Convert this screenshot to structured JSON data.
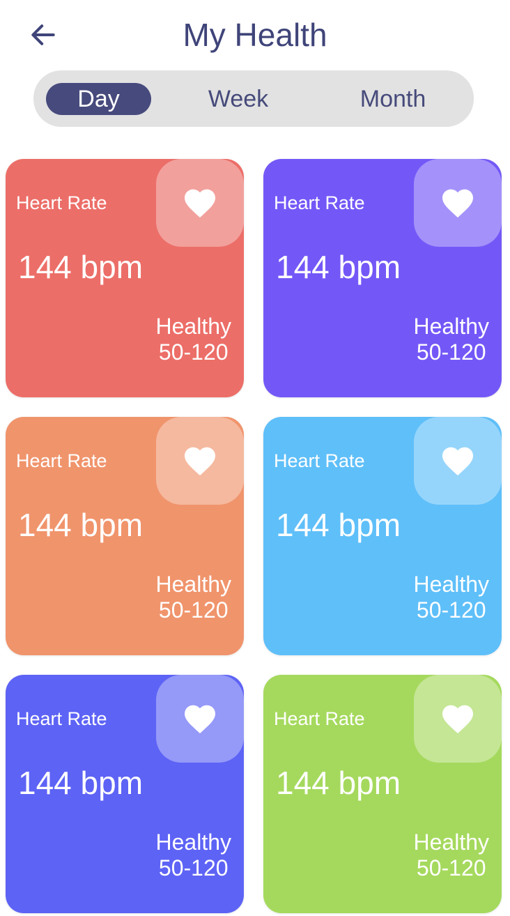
{
  "header": {
    "title": "My Health",
    "back_icon": "arrow-left-icon"
  },
  "tabs": [
    {
      "label": "Day",
      "active": true
    },
    {
      "label": "Week",
      "active": false
    },
    {
      "label": "Month",
      "active": false
    }
  ],
  "cards": [
    {
      "label": "Heart Rate",
      "value": "144 bpm",
      "status": "Healthy",
      "range": "50-120",
      "icon": "heart-icon",
      "color": "#ec6e68"
    },
    {
      "label": "Heart Rate",
      "value": "144 bpm",
      "status": "Healthy",
      "range": "50-120",
      "icon": "heart-icon",
      "color": "#7458f7"
    },
    {
      "label": "Heart Rate",
      "value": "144 bpm",
      "status": "Healthy",
      "range": "50-120",
      "icon": "heart-icon",
      "color": "#f0946c"
    },
    {
      "label": "Heart Rate",
      "value": "144 bpm",
      "status": "Healthy",
      "range": "50-120",
      "icon": "heart-icon",
      "color": "#5fbff9"
    },
    {
      "label": "Heart Rate",
      "value": "144 bpm",
      "status": "Healthy",
      "range": "50-120",
      "icon": "heart-icon",
      "color": "#5d63f5"
    },
    {
      "label": "Heart Rate",
      "value": "144 bpm",
      "status": "Healthy",
      "range": "50-120",
      "icon": "heart-icon",
      "color": "#a5d95d"
    }
  ],
  "colors": {
    "title": "#3f4479",
    "tab_active_bg": "#474a7d",
    "tab_bar_bg": "#e2e2e2"
  }
}
